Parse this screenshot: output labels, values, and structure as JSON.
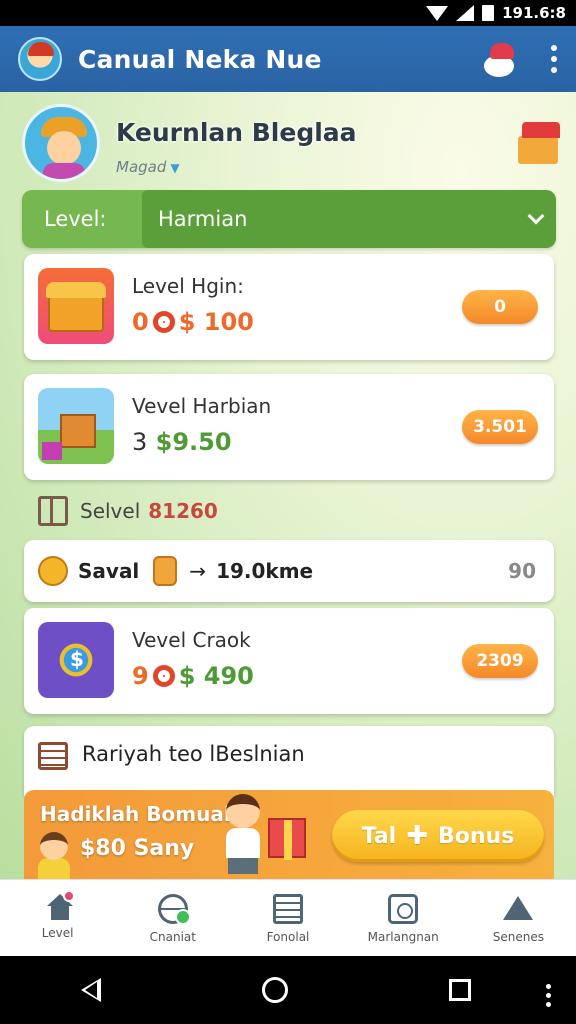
{
  "status_bar": {
    "time": "191.6:8"
  },
  "app_bar": {
    "title": "Canual Neka Nue"
  },
  "profile": {
    "name": "Keurnlan Bleglaa",
    "subtitle": "Magad"
  },
  "level_filter": {
    "label": "Level:",
    "selected": "Harmian"
  },
  "cards": [
    {
      "title": "Level Hgin:",
      "value_prefix": "0",
      "value": "$ 100",
      "button": "0",
      "value_color": "#ee6a2a"
    },
    {
      "title": "Vevel Harbian",
      "value_prefix": "3",
      "value": "$9.50",
      "button": "3.501",
      "value_color": "#4f9a35"
    },
    {
      "title": "Vevel Craok",
      "value_prefix": "9",
      "value": "$ 490",
      "button": "2309",
      "value_color": "#4f9a35"
    }
  ],
  "selvel": {
    "label": "Selvel",
    "value": "81260"
  },
  "saval": {
    "label": "Saval",
    "arrow": "→",
    "text": "19.0kme",
    "count": "90"
  },
  "ranking": {
    "label": "Rariyah teo lBeslnian"
  },
  "banner": {
    "title": "Hadiklah Bomual",
    "subtitle": "$80 Sany",
    "button": "Tal",
    "button_suffix": "Bonus"
  },
  "bottom_nav": [
    {
      "label": "Level",
      "icon": "home-icon"
    },
    {
      "label": "Cnaniat",
      "icon": "globe-icon"
    },
    {
      "label": "Fonolal",
      "icon": "document-icon"
    },
    {
      "label": "Marlangnan",
      "icon": "bag-icon"
    },
    {
      "label": "Senenes",
      "icon": "tent-icon"
    }
  ],
  "colors": {
    "app_bar": "#2e6fb3",
    "accent_green": "#76b84f",
    "accent_orange": "#f4892a"
  }
}
